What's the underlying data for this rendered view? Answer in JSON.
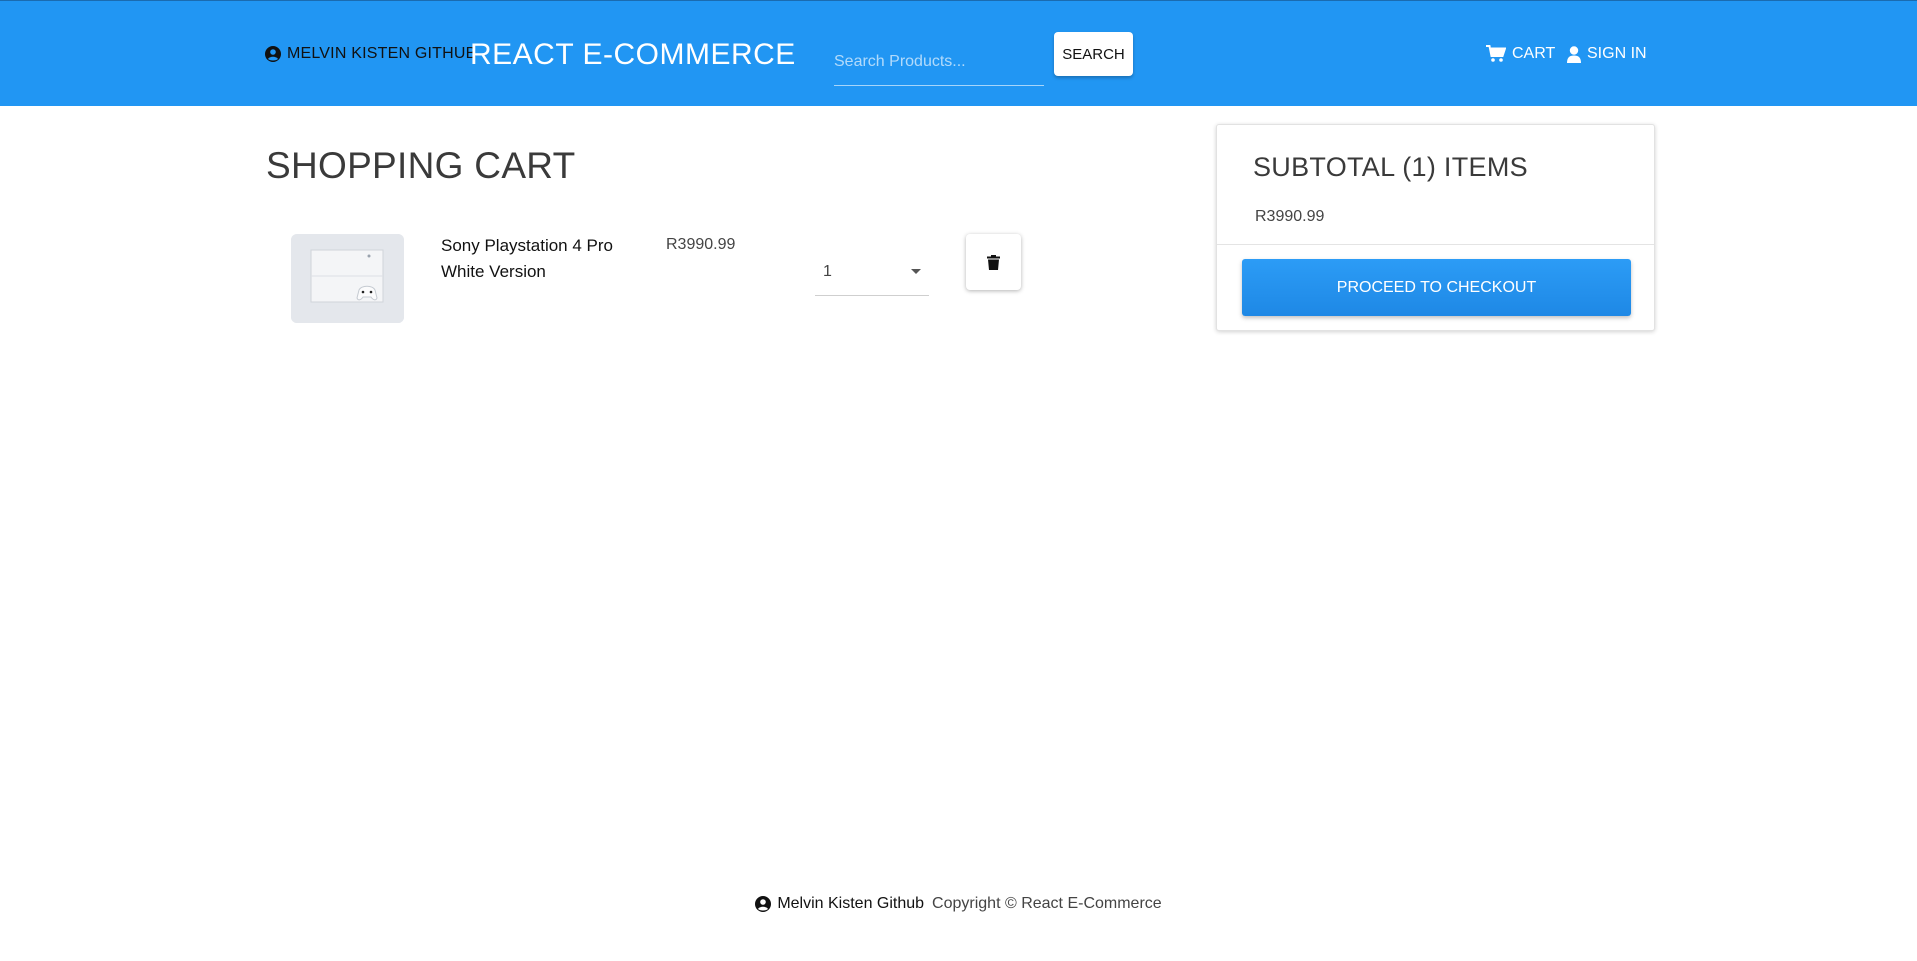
{
  "header": {
    "github_label": "MELVIN KISTEN GITHUB",
    "brand_title": "REACT E-COMMERCE",
    "search_placeholder": "Search Products...",
    "search_value": "",
    "search_button_label": "SEARCH",
    "cart_label": "CART",
    "signin_label": "SIGN IN"
  },
  "main": {
    "page_title": "SHOPPING CART",
    "items": [
      {
        "name": "Sony Playstation 4 Pro White Version",
        "price": "R3990.99",
        "quantity": "1",
        "image_icon": "playstation-product-image"
      }
    ]
  },
  "summary": {
    "title": "SUBTOTAL (1) ITEMS",
    "amount": "R3990.99",
    "checkout_label": "PROCEED TO CHECKOUT"
  },
  "footer": {
    "github_label": "Melvin Kisten Github",
    "copyright": "Copyright © React E-Commerce"
  },
  "colors": {
    "header_bg": "#2196f3",
    "checkout_bg": "#1e88e5"
  }
}
